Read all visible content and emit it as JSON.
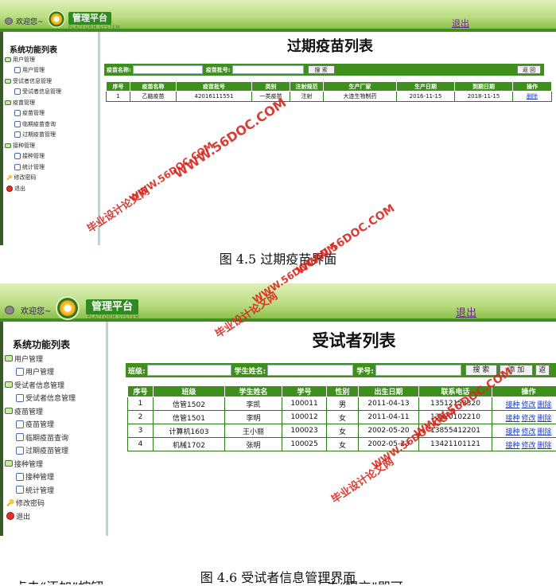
{
  "screen1": {
    "welcome": "欢迎您~",
    "logo_text": "管理平台",
    "logo_sub": "PLATFORM SYSTEM",
    "logout": "退出",
    "sidebar_title": "系统功能列表",
    "nav": [
      {
        "label": "用户管理",
        "level": 0
      },
      {
        "label": "用户管理",
        "level": 1
      },
      {
        "label": "受试者信息管理",
        "level": 0
      },
      {
        "label": "受试者信息管理",
        "level": 1
      },
      {
        "label": "疫苗管理",
        "level": 0
      },
      {
        "label": "疫苗管理",
        "level": 1
      },
      {
        "label": "临期疫苗查询",
        "level": 1
      },
      {
        "label": "过期疫苗管理",
        "level": 1
      },
      {
        "label": "接种管理",
        "level": 0
      },
      {
        "label": "接种管理",
        "level": 1
      },
      {
        "label": "统计管理",
        "level": 1
      },
      {
        "label": "修改密码",
        "level": 2
      },
      {
        "label": "退出",
        "level": 3
      }
    ],
    "page_title": "过期疫苗列表",
    "search": {
      "label1": "疫苗名称:",
      "label2": "疫苗批号:",
      "search_btn": "搜 索",
      "back_btn": "返 回"
    },
    "columns": [
      "序号",
      "疫苗名称",
      "疫苗批号",
      "类别",
      "注射规范",
      "生产厂家",
      "生产日期",
      "到期日期",
      "操作"
    ],
    "rows": [
      [
        "1",
        "乙脑疫苗",
        "42016111551",
        "一类疫苗",
        "注射",
        "大连生物制药",
        "2016-11-15",
        "2018-11-15",
        "删除"
      ]
    ]
  },
  "caption1": "图 4.5  过期疫苗界面",
  "screen2": {
    "welcome": "欢迎您~",
    "logo_text": "管理平台",
    "logo_sub": "PLATFORM SYSTEM",
    "logout": "退出",
    "sidebar_title": "系统功能列表",
    "nav": [
      {
        "label": "用户管理",
        "level": 0
      },
      {
        "label": "用户管理",
        "level": 1
      },
      {
        "label": "受试者信息管理",
        "level": 0
      },
      {
        "label": "受试者信息管理",
        "level": 1
      },
      {
        "label": "疫苗管理",
        "level": 0
      },
      {
        "label": "疫苗管理",
        "level": 1
      },
      {
        "label": "临期疫苗查询",
        "level": 1
      },
      {
        "label": "过期疫苗管理",
        "level": 1
      },
      {
        "label": "接种管理",
        "level": 0
      },
      {
        "label": "接种管理",
        "level": 1
      },
      {
        "label": "统计管理",
        "level": 1
      },
      {
        "label": "修改密码",
        "level": 2
      },
      {
        "label": "退出",
        "level": 3
      }
    ],
    "page_title": "受试者列表",
    "search": {
      "label1": "班级:",
      "label2": "学生姓名:",
      "label3": "学号:",
      "search_btn": "搜 索",
      "add_btn": "添 加",
      "back_btn": "返"
    },
    "columns": [
      "序号",
      "班级",
      "学生姓名",
      "学号",
      "性别",
      "出生日期",
      "联系电话",
      "操作"
    ],
    "rows": [
      [
        "1",
        "信管1502",
        "李凯",
        "100011",
        "男",
        "2011-04-13",
        "13512153320"
      ],
      [
        "2",
        "信管1501",
        "李明",
        "100012",
        "女",
        "2011-04-11",
        "13520102210"
      ],
      [
        "3",
        "计算机1603",
        "王小丽",
        "100023",
        "女",
        "2002-05-20",
        "13855412201"
      ],
      [
        "4",
        "机械1702",
        "张明",
        "100025",
        "女",
        "2002-05-23",
        "13421101121"
      ]
    ],
    "ops": [
      "接种",
      "修改",
      "删除"
    ]
  },
  "caption2": "图 4.6 受试者信息管理界面",
  "bottom_text": "点击“添加”按钮，　　　　　　　　　　　　　　　，点击“提交”即可",
  "watermark_url": "WWW.56DOC.COM",
  "watermark_cn": "毕业设计论文网",
  "colors": {
    "header_green": "#3f8f1c",
    "watermark_red": "#d8261c",
    "link_blue": "#2040c0",
    "logout_purple": "#6b2b84"
  }
}
